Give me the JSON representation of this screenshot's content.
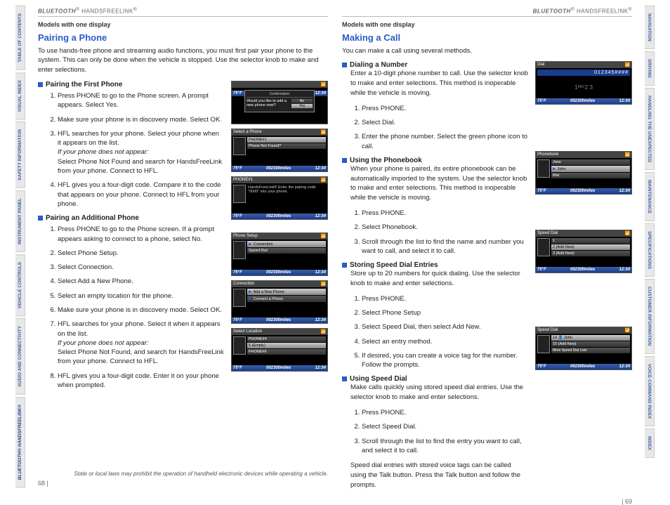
{
  "header": {
    "brand_it": "BLUETOOTH",
    "brand_sup": "®",
    "brand_rest": " HANDSFREELINK",
    "brand_sup2": "®"
  },
  "left_tabs": [
    "TABLE OF CONTENTS",
    "VISUAL INDEX",
    "SAFETY INFORMATION",
    "INSTRUMENT PANEL",
    "VEHICLE CONTROLS",
    "AUDIO AND CONNECTIVITY",
    "BLUETOOTH® HANDSFREELINK®"
  ],
  "right_tabs": [
    "NAVIGATION",
    "DRIVING",
    "HANDLING THE UNEXPECTED",
    "MAINTENANCE",
    "SPECIFICATIONS",
    "CUSTOMER INFORMATION",
    "VOICE COMMAND INDEX",
    "INDEX"
  ],
  "status": {
    "temp": "75°F",
    "odo": "002300miles",
    "time": "12:34"
  },
  "screens": {
    "confirm": {
      "title": "Confirmation",
      "q": "Would you like to add a new phone now?",
      "btn1": "No",
      "btn2": "Yes"
    },
    "selectPhone": {
      "title": "Select a Phone",
      "r1": "PHONE#1",
      "r2": "Phone Not Found?"
    },
    "phone1": {
      "title": "PHONE#1",
      "msg": "HandsFreeLink® Enter the pairing code \"0000\" into your phone."
    },
    "phoneSetup": {
      "title": "Phone Setup",
      "r1": "Connection",
      "r2": "Speed Dial"
    },
    "connection": {
      "title": "Connection",
      "r1": "Add a New Phone",
      "r2": "Connect a Phone"
    },
    "selectLoc": {
      "title": "Select Location",
      "r1": "PHONE#4",
      "r2": "5 (Empty)",
      "r3": "PHONE#6"
    },
    "dial": {
      "title": "Dial",
      "digits": "012345####",
      "hint": "ABC"
    },
    "phonebook": {
      "title": "Phonebook",
      "r1": "Jane",
      "r2": "John",
      "r3": "Mat"
    },
    "speed1": {
      "title": "Speed Dial",
      "r1": "1",
      "r2": "2   (Add New)",
      "r3": "3   (Add New)"
    },
    "speed2": {
      "title": "Speed Dial",
      "r1": "14 👤 John",
      "r2": "15   (Add New)",
      "r3": "More Speed Dial Lists"
    }
  },
  "left": {
    "subhead": "Models with one display",
    "title": "Pairing a Phone",
    "intro": "To use hands-free phone and streaming audio functions, you must first pair your phone to the system. This can only be done when the vehicle is stopped. Use the selector knob to make and enter selections.",
    "s1_title": "Pairing the First Phone",
    "s1_li1": "Press PHONE to go to the Phone screen. A prompt appears. Select Yes.",
    "s1_li2": "Make sure your phone is in discovery mode. Select OK.",
    "s1_li3a": "HFL searches for your phone. Select your phone when it appears on the list.",
    "s1_li3b": "If your phone does not appear:",
    "s1_li3c": "Select Phone Not Found and search for HandsFreeLink from your phone. Connect to HFL.",
    "s1_li4": "HFL gives you a four-digit code. Compare it to the code that appears on your phone. Connect to HFL from your phone.",
    "s2_title": "Pairing an Additional Phone",
    "s2_li1": "Press PHONE to go to the Phone screen. If a prompt appears asking to connect to a phone, select No.",
    "s2_li2": "Select Phone Setup.",
    "s2_li3": "Select Connection.",
    "s2_li4": "Select Add a New Phone.",
    "s2_li5": "Select an empty location for the phone.",
    "s2_li6": "Make sure your phone is in discovery mode. Select OK.",
    "s2_li7a": "HFL searches for your phone. Select it when it appears on the list.",
    "s2_li7b": "If your phone does not appear:",
    "s2_li7c": "Select Phone Not Found, and search for HandsFreeLink from your phone. Connect to HFL.",
    "s2_li8": "HFL gives you a four-digit code. Enter it on your phone when prompted.",
    "footnote": "State or local laws may prohibit the operation of handheld electronic devices while operating a vehicle.",
    "pagenum": "68  |"
  },
  "right": {
    "subhead": "Models with one display",
    "title": "Making a Call",
    "intro": "You can make a call using several methods.",
    "s1_title": "Dialing a Number",
    "s1_body": "Enter a 10-digit phone number to call. Use the selector knob to make and enter selections. This method is inoperable while the vehicle is moving.",
    "s1_li1": "Press PHONE.",
    "s1_li2": "Select Dial.",
    "s1_li3": "Enter the phone number. Select the green phone icon to call.",
    "s2_title": "Using the Phonebook",
    "s2_body": "When your phone is paired, its entire phonebook can be automatically imported to the system. Use the selector knob to make and enter selections. This method is inoperable while the vehicle is moving.",
    "s2_li1": "Press PHONE.",
    "s2_li2": "Select Phonebook.",
    "s2_li3": "Scroll through the list to find the name and number you want to call, and select it to call.",
    "s3_title": "Storing Speed Dial Entries",
    "s3_body": "Store up to 20 numbers for quick dialing. Use the selector knob to make and enter selections.",
    "s3_li1": "Press PHONE.",
    "s3_li2": "Select Phone Setup",
    "s3_li3": "Select Speed Dial, then select Add New.",
    "s3_li4": "Select an entry method.",
    "s3_li5": "If desired, you can create a voice tag for the number. Follow the prompts.",
    "s4_title": "Using Speed Dial",
    "s4_body": "Make calls quickly using stored speed dial entries. Use the selector knob to make and enter selections.",
    "s4_li1": "Press PHONE.",
    "s4_li2": "Select Speed Dial.",
    "s4_li3": "Scroll through the list to find the entry you want to call, and select it to call.",
    "outro": "Speed dial entries with stored voice tags can be called using the Talk button. Press the Talk button and follow the prompts.",
    "pagenum": "|  69"
  }
}
